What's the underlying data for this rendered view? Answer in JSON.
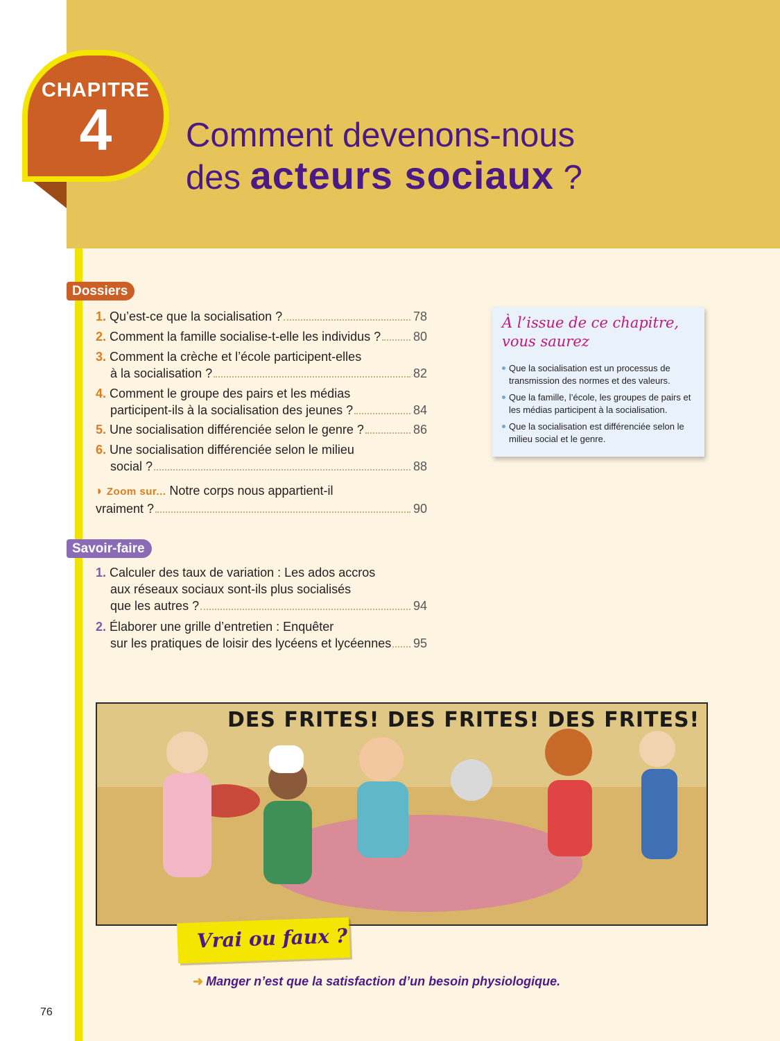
{
  "chapter": {
    "label": "CHAPITRE",
    "number": "4"
  },
  "title": {
    "line1": "Comment devenons-nous",
    "line2_pre": "des",
    "line2_bold": "acteurs sociaux",
    "line2_post": "?"
  },
  "dossiers": {
    "label": "Dossiers",
    "items": [
      {
        "num": "1.",
        "lines": [
          "Qu’est-ce que la socialisation ?"
        ],
        "page": "78"
      },
      {
        "num": "2.",
        "lines": [
          "Comment la famille socialise-t-elle les individus ?"
        ],
        "page": "80"
      },
      {
        "num": "3.",
        "lines": [
          "Comment la crèche et l’école participent-elles",
          "à la socialisation ?"
        ],
        "page": "82"
      },
      {
        "num": "4.",
        "lines": [
          "Comment le groupe des pairs et les médias",
          "participent-ils à la socialisation des jeunes ?"
        ],
        "page": "84"
      },
      {
        "num": "5.",
        "lines": [
          "Une socialisation différenciée selon le genre ?"
        ],
        "page": "86"
      },
      {
        "num": "6.",
        "lines": [
          "Une socialisation différenciée selon le milieu",
          "social ?"
        ],
        "page": "88"
      }
    ],
    "zoom": {
      "marker": "◗",
      "label": "Zoom sur...",
      "line1": "Notre corps nous appartient-il",
      "line2": "vraiment ?",
      "page": "90"
    }
  },
  "savoir_faire": {
    "label": "Savoir-faire",
    "items": [
      {
        "num": "1.",
        "lines": [
          "Calculer des taux de variation : Les ados accros",
          "aux réseaux sociaux sont-ils plus socialisés",
          "que les autres ?"
        ],
        "page": "94"
      },
      {
        "num": "2.",
        "lines": [
          "Élaborer une grille d’entretien : Enquêter",
          "sur les pratiques de loisir des lycéens et lycéennes"
        ],
        "page": "95"
      }
    ]
  },
  "note": {
    "title_line1": "À l’issue de ce chapitre,",
    "title_line2": "vous saurez",
    "items": [
      "Que la socialisation est un processus de transmission des normes et des valeurs.",
      "Que la famille, l’école, les groupes de pairs et les médias participent à la socialisation.",
      "Que la socialisation est différenciée selon le milieu social et le genre."
    ]
  },
  "comic": {
    "caption": "DES FRITES! DES FRITES! DES FRITES!"
  },
  "vrai_ou_faux": {
    "label": "Vrai ou faux ?",
    "arrow": "➜",
    "statement": "Manger n’est que la satisfaction d’un besoin physiologique."
  },
  "page_number": "76",
  "colors": {
    "header": "#e6c45a",
    "accent_orange": "#cc5f26",
    "title_purple": "#4b1a85",
    "highlight_yellow": "#f4e600",
    "note_pink": "#c2187b"
  }
}
